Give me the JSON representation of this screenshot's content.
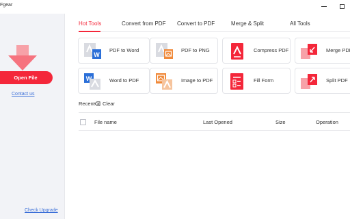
{
  "window": {
    "title": "Fgear",
    "minimize_icon": "minimize-icon",
    "maximize_icon": "maximize-icon"
  },
  "sidebar": {
    "open_file_label": "Open File",
    "contact_label": "Contact us",
    "upgrade_label": "Check Upgrade",
    "accent_color": "#f4273a"
  },
  "tabs": [
    {
      "label": "Hot Tools",
      "active": true
    },
    {
      "label": "Convert from PDF",
      "active": false
    },
    {
      "label": "Convert to PDF",
      "active": false
    },
    {
      "label": "Merge & Split",
      "active": false
    },
    {
      "label": "All Tools",
      "active": false
    }
  ],
  "tools": [
    {
      "label": "PDF to Word",
      "icon": "pdf-to-word-icon"
    },
    {
      "label": "PDF to PNG",
      "icon": "pdf-to-png-icon"
    },
    {
      "label": "Compress PDF",
      "icon": "compress-pdf-icon"
    },
    {
      "label": "Merge PDF",
      "icon": "merge-pdf-icon"
    },
    {
      "label": "Word to PDF",
      "icon": "word-to-pdf-icon"
    },
    {
      "label": "Image to PDF",
      "icon": "image-to-pdf-icon"
    },
    {
      "label": "Fill Form",
      "icon": "fill-form-icon"
    },
    {
      "label": "Split PDF",
      "icon": "split-pdf-icon"
    }
  ],
  "recent": {
    "label": "Recent",
    "clear_label": "Clear",
    "columns": [
      "File name",
      "Last Opened",
      "Size",
      "Operation"
    ],
    "rows": []
  },
  "colors": {
    "accent": "#f4273a",
    "word_blue": "#2b6fd8",
    "image_orange": "#f08a3b"
  }
}
